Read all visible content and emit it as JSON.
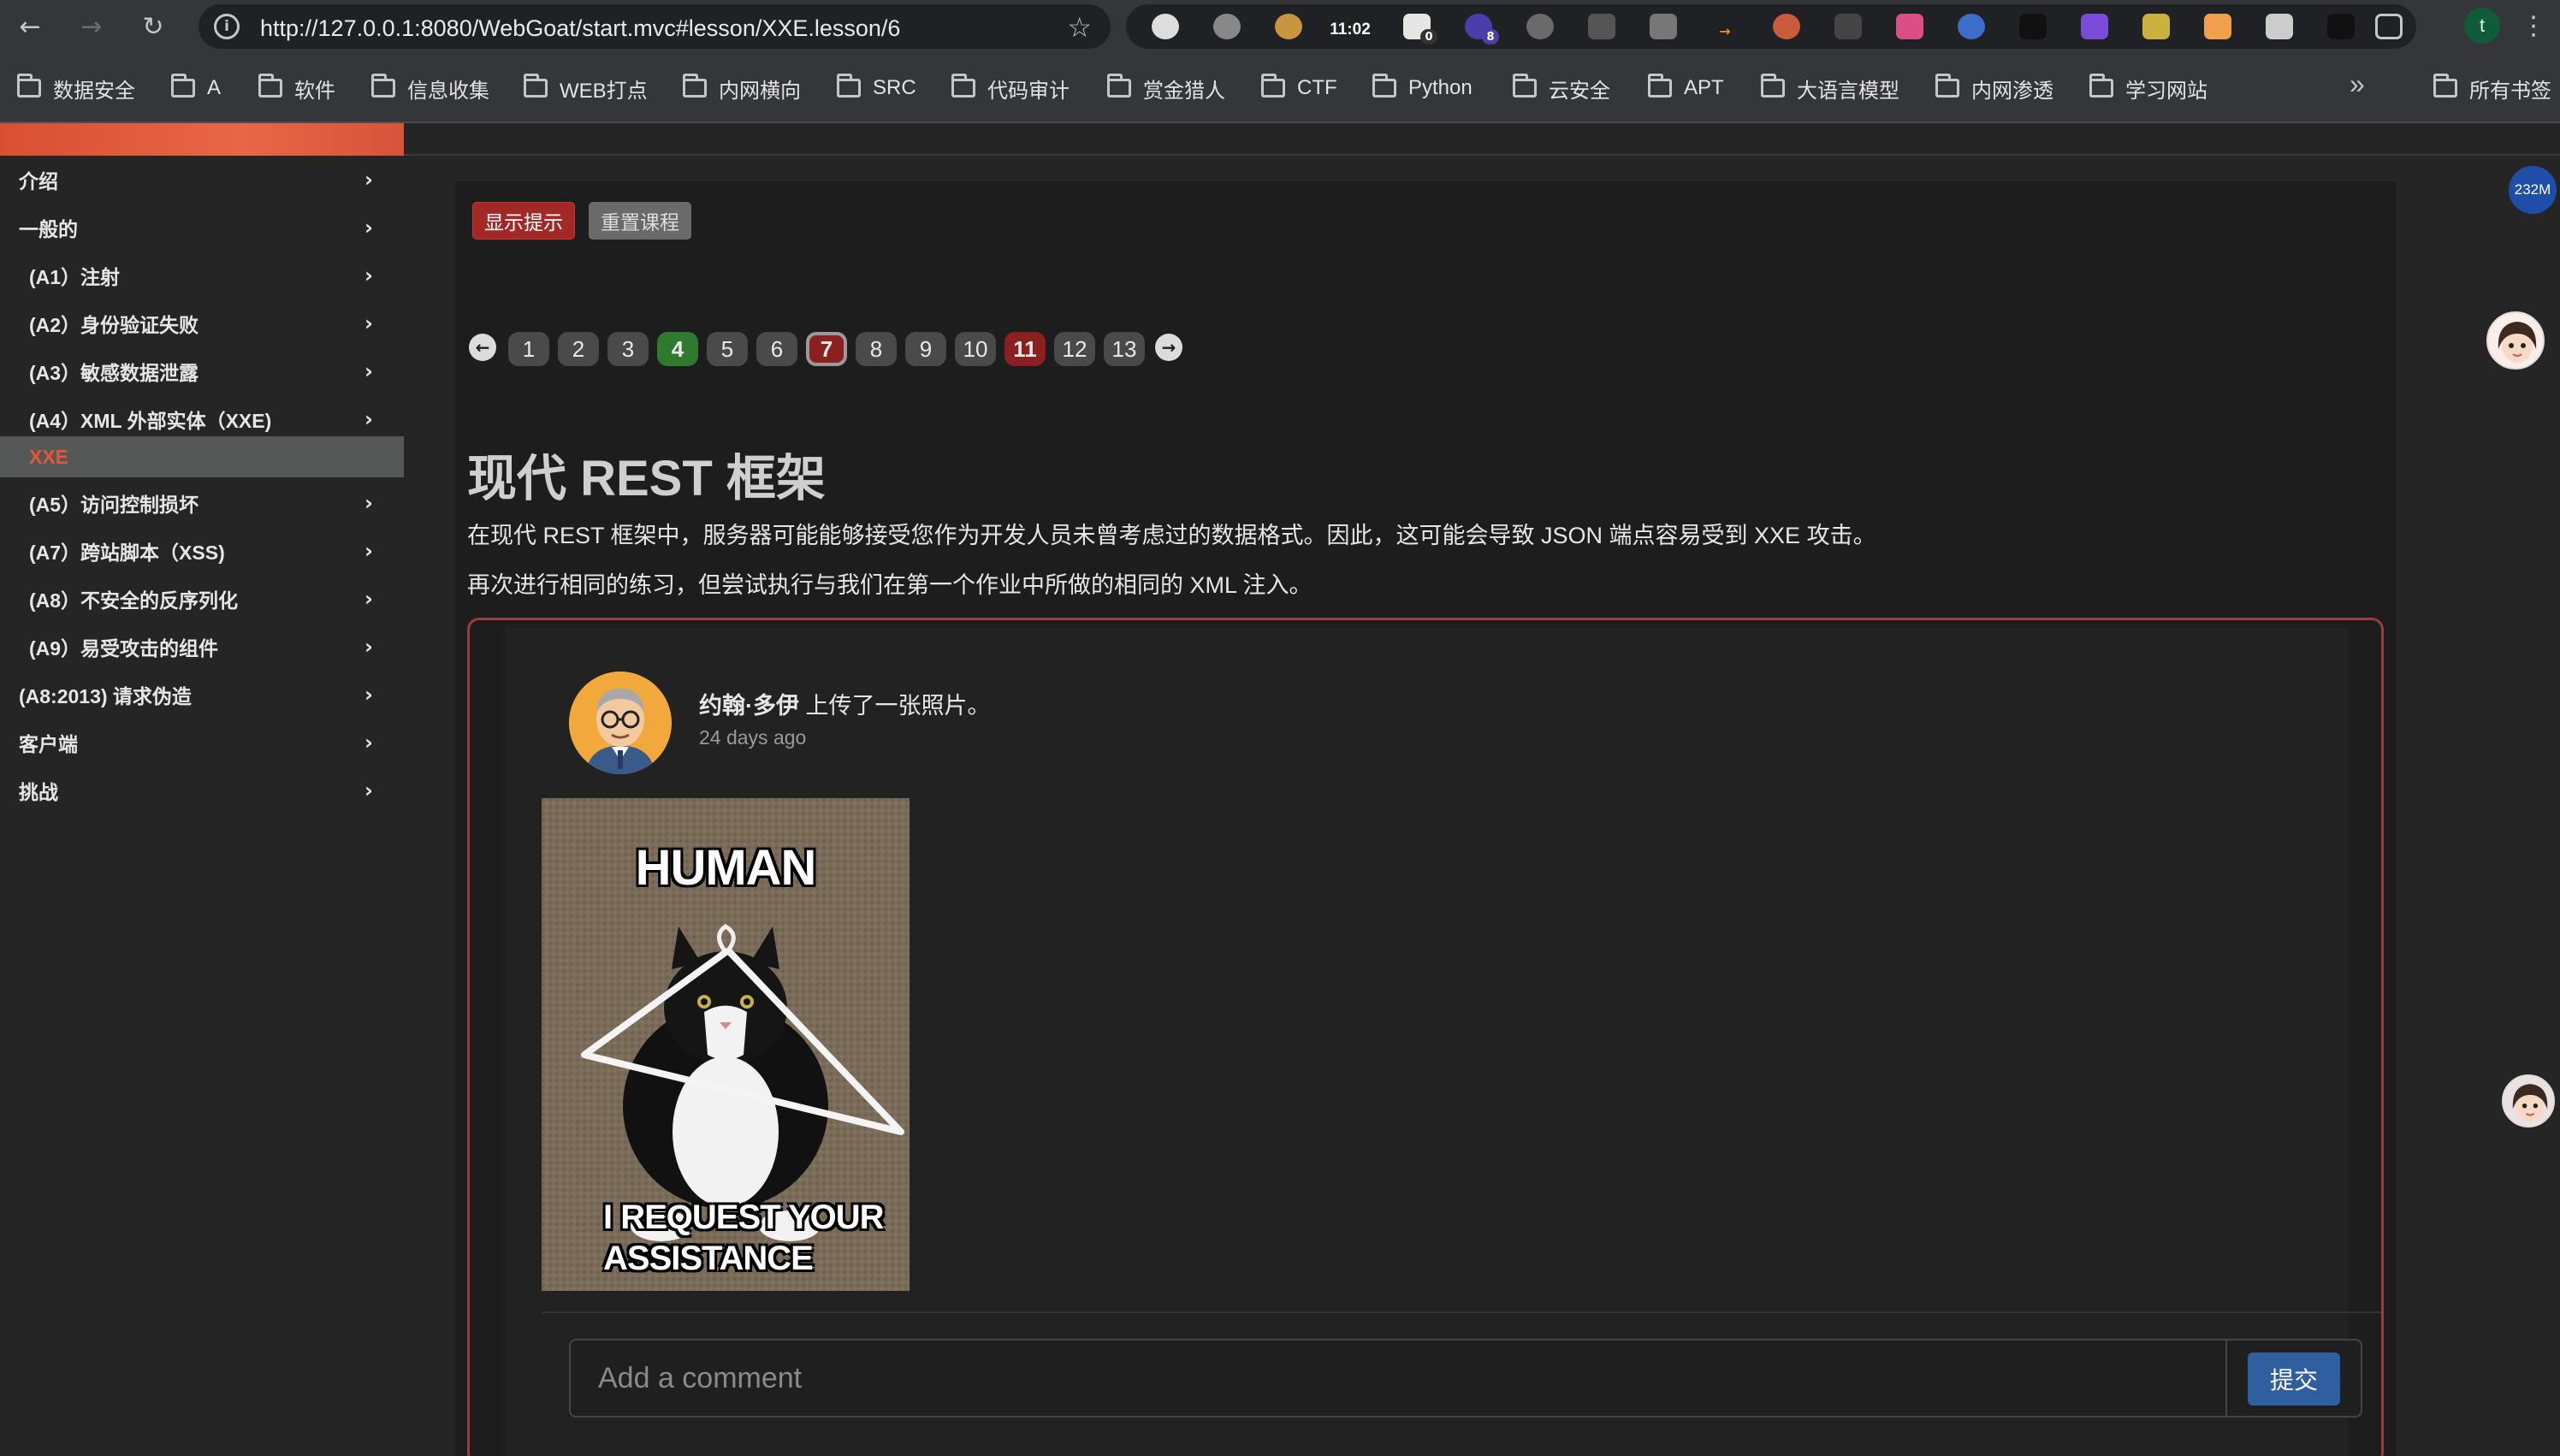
{
  "browser": {
    "url": "http://127.0.0.1:8080/WebGoat/start.mvc#lesson/XXE.lesson/6",
    "clock": "11:02",
    "ext_badge_1": "0",
    "ext_badge_2": "8",
    "memory": "232M",
    "profile_initial": "t",
    "icons": [
      "back-arrow-icon",
      "forward-arrow-icon",
      "reload-icon",
      "info-icon",
      "star-icon",
      "extensions-icon",
      "kebab-menu-icon"
    ]
  },
  "bookmarks": {
    "items": [
      "数据安全",
      "A",
      "软件",
      "信息收集",
      "WEB打点",
      "内网横向",
      "SRC",
      "代码审计",
      "赏金猎人",
      "CTF",
      "Python",
      "云安全",
      "APT",
      "大语言模型",
      "内网渗透",
      "学习网站"
    ],
    "more": "»",
    "all": "所有书签"
  },
  "sidebar": {
    "items": [
      {
        "label": "介绍"
      },
      {
        "label": "一般的"
      },
      {
        "label": "(A1）注射"
      },
      {
        "label": "(A2）身份验证失败"
      },
      {
        "label": "(A3）敏感数据泄露"
      },
      {
        "label": "(A4）XML 外部实体（XXE)"
      },
      {
        "label": "XXE"
      },
      {
        "label": "(A5）访问控制损坏"
      },
      {
        "label": "(A7）跨站脚本（XSS)"
      },
      {
        "label": "(A8）不安全的反序列化"
      },
      {
        "label": "(A9）易受攻击的组件"
      },
      {
        "label": "(A8:2013) 请求伪造"
      },
      {
        "label": "客户端"
      },
      {
        "label": "挑战"
      }
    ]
  },
  "lesson": {
    "show_hints": "显示提示",
    "reset": "重置课程",
    "pages": [
      "1",
      "2",
      "3",
      "4",
      "5",
      "6",
      "7",
      "8",
      "9",
      "10",
      "11",
      "12",
      "13"
    ],
    "title": "现代 REST 框架",
    "para1": "在现代 REST 框架中，服务器可能能够接受您作为开发人员未曾考虑过的数据格式。因此，这可能会导致 JSON 端点容易受到 XXE 攻击。",
    "para2": "再次进行相同的练习，但尝试执行与我们在第一个作业中所做的相同的 XML 注入。"
  },
  "post": {
    "author": "约翰·多伊",
    "action": " 上传了一张照片。",
    "time": "24 days ago",
    "meme_top": "HUMAN",
    "meme_bottom_1": "I REQUEST YOUR",
    "meme_bottom_2": "ASSISTANCE",
    "comment_placeholder": "Add a comment",
    "submit": "提交"
  },
  "colors": {
    "accent_red": "#a32828",
    "done_green": "#2f7a2f",
    "active_link": "#e4563a",
    "submit_blue": "#2f5f9e"
  }
}
